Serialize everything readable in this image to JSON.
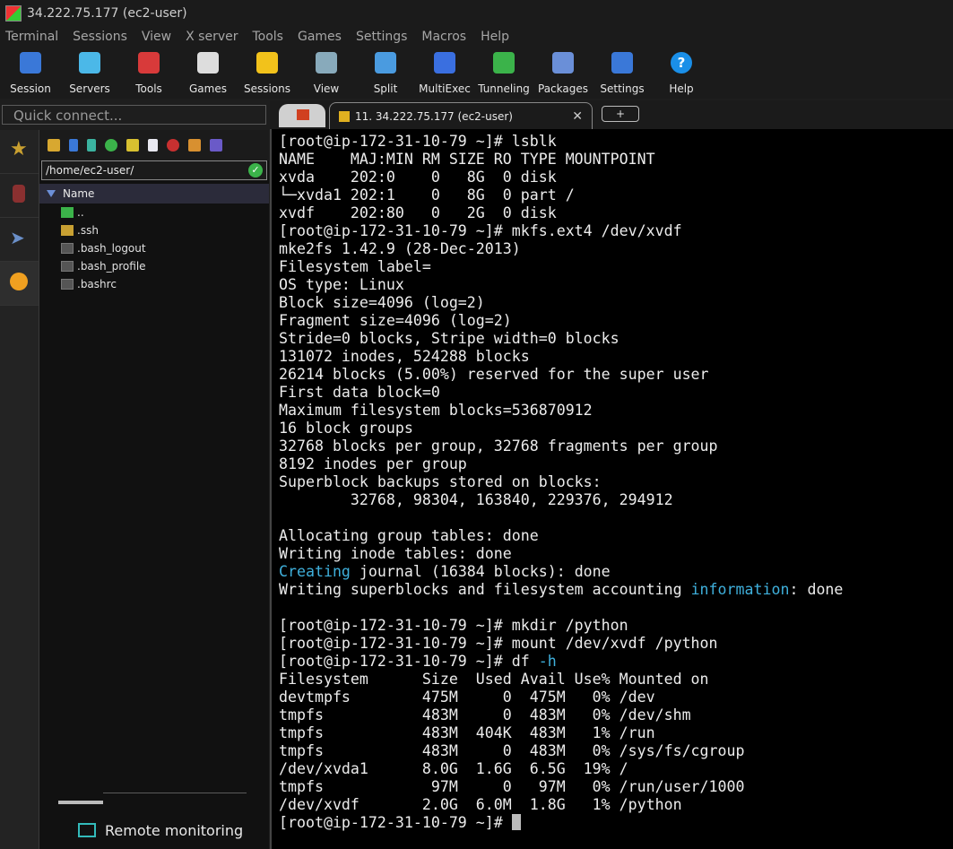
{
  "window": {
    "title": "34.222.75.177 (ec2-user)"
  },
  "menu": [
    "Terminal",
    "Sessions",
    "View",
    "X server",
    "Tools",
    "Games",
    "Settings",
    "Macros",
    "Help"
  ],
  "toolbar": [
    {
      "label": "Session",
      "icon": "session-icon",
      "color": "#3a78d8"
    },
    {
      "label": "Servers",
      "icon": "servers-icon",
      "color": "#4bb8e8"
    },
    {
      "label": "Tools",
      "icon": "tools-icon",
      "color": "#d83a3a"
    },
    {
      "label": "Games",
      "icon": "games-icon",
      "color": "#dddddd"
    },
    {
      "label": "Sessions",
      "icon": "sessions-star-icon",
      "color": "#f2c21b"
    },
    {
      "label": "View",
      "icon": "view-icon",
      "color": "#8ab"
    },
    {
      "label": "Split",
      "icon": "split-icon",
      "color": "#4a9be0"
    },
    {
      "label": "MultiExec",
      "icon": "multiexec-icon",
      "color": "#3a6fe0"
    },
    {
      "label": "Tunneling",
      "icon": "tunneling-icon",
      "color": "#3bb34a"
    },
    {
      "label": "Packages",
      "icon": "packages-icon",
      "color": "#6a8fd8"
    },
    {
      "label": "Settings",
      "icon": "settings-icon",
      "color": "#3a78d8"
    },
    {
      "label": "Help",
      "icon": "help-icon",
      "color": "#1a8fe8"
    }
  ],
  "quick_connect": {
    "placeholder": "Quick connect..."
  },
  "sftp": {
    "path": "/home/ec2-user/",
    "column": "Name",
    "files": [
      {
        "name": "..",
        "icon": "parent-folder-icon",
        "color": "#3bb34a"
      },
      {
        "name": ".ssh",
        "icon": "folder-icon",
        "color": "#c8a032"
      },
      {
        "name": ".bash_logout",
        "icon": "file-icon",
        "color": "#555555"
      },
      {
        "name": ".bash_profile",
        "icon": "file-icon",
        "color": "#555555"
      },
      {
        "name": ".bashrc",
        "icon": "file-icon",
        "color": "#555555"
      }
    ]
  },
  "remote_monitoring": "Remote monitoring",
  "tab": {
    "label": "11. 34.222.75.177 (ec2-user)",
    "add": "+"
  },
  "terminal": {
    "lines": [
      "[root@ip-172-31-10-79 ~]# lsblk",
      "NAME    MAJ:MIN RM SIZE RO TYPE MOUNTPOINT",
      "xvda    202:0    0   8G  0 disk",
      "└─xvda1 202:1    0   8G  0 part /",
      "xvdf    202:80   0   2G  0 disk",
      "[root@ip-172-31-10-79 ~]# mkfs.ext4 /dev/xvdf",
      "mke2fs 1.42.9 (28-Dec-2013)",
      "Filesystem label=",
      "OS type: Linux",
      "Block size=4096 (log=2)",
      "Fragment size=4096 (log=2)",
      "Stride=0 blocks, Stripe width=0 blocks",
      "131072 inodes, 524288 blocks",
      "26214 blocks (5.00%) reserved for the super user",
      "First data block=0",
      "Maximum filesystem blocks=536870912",
      "16 block groups",
      "32768 blocks per group, 32768 fragments per group",
      "8192 inodes per group",
      "Superblock backups stored on blocks:",
      "        32768, 98304, 163840, 229376, 294912",
      "",
      "Allocating group tables: done",
      "Writing inode tables: done",
      "Creating journal (16384 blocks): done",
      "Writing superblocks and filesystem accounting information: done",
      "",
      "[root@ip-172-31-10-79 ~]# mkdir /python",
      "[root@ip-172-31-10-79 ~]# mount /dev/xvdf /python",
      "[root@ip-172-31-10-79 ~]# df -h",
      "Filesystem      Size  Used Avail Use% Mounted on",
      "devtmpfs        475M     0  475M   0% /dev",
      "tmpfs           483M     0  483M   0% /dev/shm",
      "tmpfs           483M  404K  483M   1% /run",
      "tmpfs           483M     0  483M   0% /sys/fs/cgroup",
      "/dev/xvda1      8.0G  1.6G  6.5G  19% /",
      "tmpfs            97M     0   97M   0% /run/user/1000",
      "/dev/xvdf       2.0G  6.0M  1.8G   1% /python",
      "[root@ip-172-31-10-79 ~]# "
    ],
    "highlight_words": [
      "Creating",
      "information",
      "-h"
    ]
  }
}
